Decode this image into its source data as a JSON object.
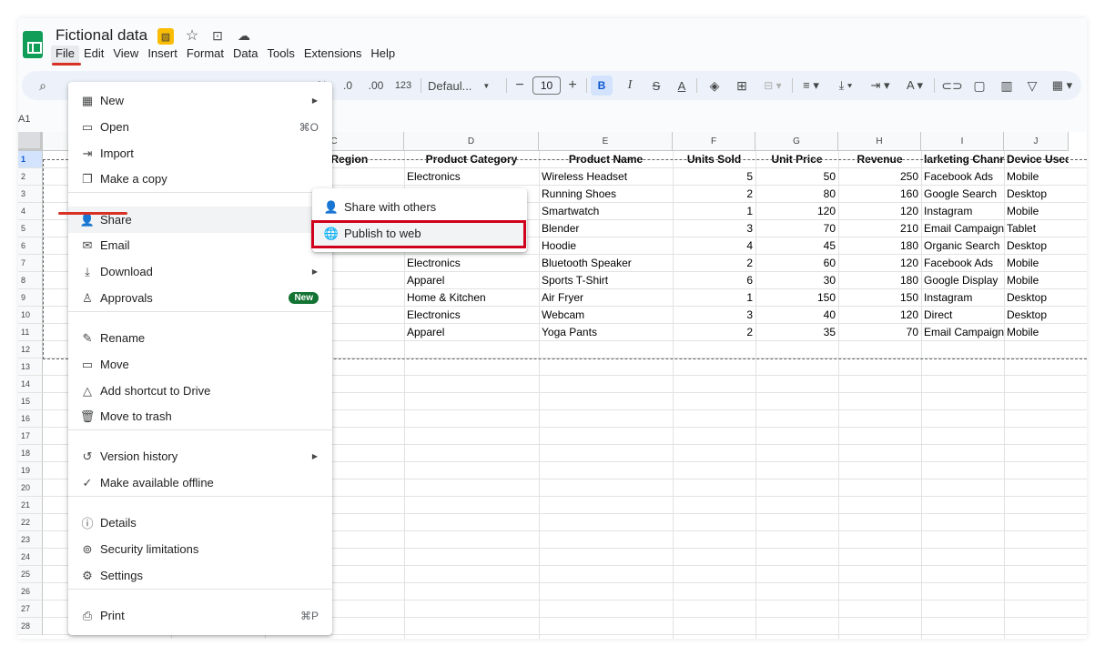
{
  "doc": {
    "title": "Fictional data"
  },
  "menubar": [
    "File",
    "Edit",
    "View",
    "Insert",
    "Format",
    "Data",
    "Tools",
    "Extensions",
    "Help"
  ],
  "toolbar": {
    "percent": "%",
    "dec_decrease": ".0",
    "dec_increase": ".00",
    "number_format": "123",
    "font": "Defaul...",
    "font_size": "10",
    "bold": "B",
    "italic": "I",
    "strike": "S",
    "text_color": "A"
  },
  "namebox": "A1",
  "grid": {
    "columns": [
      "C",
      "D",
      "E",
      "F",
      "G",
      "H",
      "I",
      "J"
    ],
    "rows": [
      "1",
      "2",
      "3",
      "4",
      "5",
      "6",
      "7",
      "8",
      "9",
      "10",
      "11",
      "12",
      "13",
      "14",
      "15",
      "16",
      "17",
      "18",
      "19",
      "20",
      "21",
      "22",
      "23",
      "24",
      "25",
      "26",
      "27",
      "28"
    ],
    "headers": [
      "omer Region",
      "Product Category",
      "Product Name",
      "Units Sold",
      "Unit Price",
      "Revenue",
      "larketing Channe",
      "Device Used"
    ],
    "data": [
      [
        "erica",
        "Electronics",
        "Wireless Headset",
        "5",
        "50",
        "250",
        "Facebook Ads",
        "Mobile"
      ],
      [
        "",
        "",
        "Running Shoes",
        "2",
        "80",
        "160",
        "Google Search",
        "Desktop"
      ],
      [
        "",
        "",
        "Smartwatch",
        "1",
        "120",
        "120",
        "Instagram",
        "Mobile"
      ],
      [
        "",
        "",
        "Blender",
        "3",
        "70",
        "210",
        "Email Campaign",
        "Tablet"
      ],
      [
        "",
        "",
        "Hoodie",
        "4",
        "45",
        "180",
        "Organic Search",
        "Desktop"
      ],
      [
        "",
        "Electronics",
        "Bluetooth Speaker",
        "2",
        "60",
        "120",
        "Facebook Ads",
        "Mobile"
      ],
      [
        "nerica",
        "Apparel",
        "Sports T-Shirt",
        "6",
        "30",
        "180",
        "Google Display",
        "Mobile"
      ],
      [
        "",
        "Home & Kitchen",
        "Air Fryer",
        "1",
        "150",
        "150",
        "Instagram",
        "Desktop"
      ],
      [
        "nerica",
        "Electronics",
        "Webcam",
        "3",
        "40",
        "120",
        "Direct",
        "Desktop"
      ],
      [
        "",
        "Apparel",
        "Yoga Pants",
        "2",
        "35",
        "70",
        "Email Campaign",
        "Mobile"
      ]
    ]
  },
  "file_menu": {
    "items": [
      {
        "label": "New",
        "icon": "new-sheet-icon",
        "glyph": "▦",
        "arrow": true
      },
      {
        "label": "Open",
        "icon": "folder-icon",
        "glyph": "▭",
        "shortcut": "⌘O"
      },
      {
        "label": "Import",
        "icon": "import-icon",
        "glyph": "⇥"
      },
      {
        "label": "Make a copy",
        "icon": "copy-icon",
        "glyph": "❐"
      },
      {
        "label": "Share",
        "icon": "person-add-icon",
        "glyph": "👤",
        "arrow": true
      },
      {
        "label": "Email",
        "icon": "email-icon",
        "glyph": "✉",
        "arrow": true
      },
      {
        "label": "Download",
        "icon": "download-icon",
        "glyph": "⤓",
        "arrow": true
      },
      {
        "label": "Approvals",
        "icon": "approvals-icon",
        "glyph": "♙",
        "badge": "New"
      },
      {
        "label": "Rename",
        "icon": "pencil-icon",
        "glyph": "✎"
      },
      {
        "label": "Move",
        "icon": "move-folder-icon",
        "glyph": "▭"
      },
      {
        "label": "Add shortcut to Drive",
        "icon": "drive-shortcut-icon",
        "glyph": "△"
      },
      {
        "label": "Move to trash",
        "icon": "trash-icon",
        "glyph": "🗑"
      },
      {
        "label": "Version history",
        "icon": "history-icon",
        "glyph": "↺",
        "arrow": true
      },
      {
        "label": "Make available offline",
        "icon": "offline-icon",
        "glyph": "✓"
      },
      {
        "label": "Details",
        "icon": "info-icon",
        "glyph": "ⓘ"
      },
      {
        "label": "Security limitations",
        "icon": "security-icon",
        "glyph": "⊚"
      },
      {
        "label": "Settings",
        "icon": "gear-icon",
        "glyph": "⚙"
      },
      {
        "label": "Print",
        "icon": "print-icon",
        "glyph": "⎙",
        "shortcut": "⌘P"
      }
    ]
  },
  "share_menu": {
    "items": [
      {
        "label": "Share with others",
        "icon": "person-add-icon",
        "glyph": "👤"
      },
      {
        "label": "Publish to web",
        "icon": "globe-icon",
        "glyph": "🌐"
      }
    ]
  },
  "colors": {
    "accent": "#0b57d0",
    "highlight": "#d0021b",
    "sheets_green": "#0f9d58"
  }
}
